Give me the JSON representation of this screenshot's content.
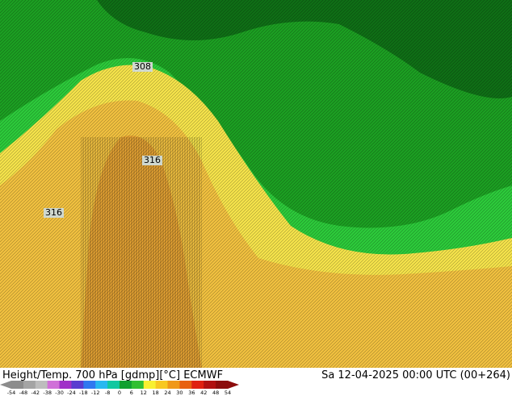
{
  "map": {
    "contour_labels": [
      "308",
      "316",
      "316"
    ],
    "colors": {
      "dark_green": "#0f6e16",
      "mid_green": "#1c9e22",
      "bright_green": "#2cc93a",
      "yellow": "#f3e14a",
      "gold": "#efbf3f",
      "orange": "#e4a233"
    }
  },
  "footer": {
    "title": "Height/Temp. 700 hPa [gdmp][°C] ECMWF",
    "datetime": "Sa 12-04-2025 00:00 UTC (00+264)"
  },
  "colorbar": {
    "ticks": [
      "-54",
      "-48",
      "-42",
      "-38",
      "-30",
      "-24",
      "-18",
      "-12",
      "-8",
      "0",
      "6",
      "12",
      "18",
      "24",
      "30",
      "36",
      "42",
      "48",
      "54"
    ],
    "colors": [
      "#8c8c8c",
      "#a4a4a4",
      "#bdbdbd",
      "#d070d8",
      "#a030c8",
      "#5a3cd0",
      "#2f78f0",
      "#27b8f0",
      "#10c8a0",
      "#10a030",
      "#30c030",
      "#f8f030",
      "#f8c820",
      "#f09818",
      "#e86010",
      "#e02010",
      "#b01010",
      "#8c0c0c"
    ]
  }
}
